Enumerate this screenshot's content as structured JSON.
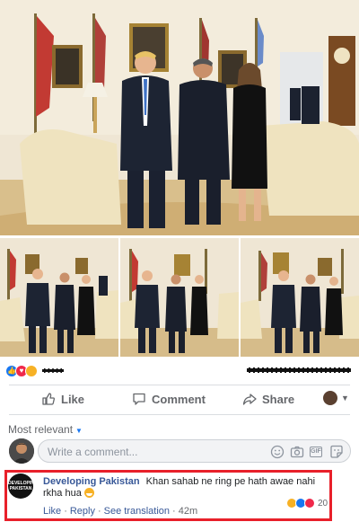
{
  "post": {
    "photos": [
      {
        "name": "main-photo"
      },
      {
        "name": "thumb-1"
      },
      {
        "name": "thumb-2"
      },
      {
        "name": "thumb-3"
      }
    ]
  },
  "summary": {
    "reactions": [
      "like-icon",
      "love-icon",
      "haha-icon"
    ]
  },
  "actions": {
    "like_label": "Like",
    "comment_label": "Comment",
    "share_label": "Share"
  },
  "comments": {
    "sort_label": "Most relevant",
    "composer_placeholder": "Write a comment...",
    "items": [
      {
        "avatar_text": "DEVELOPING PAKISTAN",
        "author": "Developing Pakistan",
        "text": "Khan sahab ne ring pe hath awae nahi rkha hua",
        "like_label": "Like",
        "reply_label": "Reply",
        "translate_label": "See translation",
        "time": "42m",
        "reaction_count": "20"
      }
    ]
  },
  "colors": {
    "link": "#385898",
    "accent": "#1877f2",
    "highlight": "#e8202a"
  }
}
